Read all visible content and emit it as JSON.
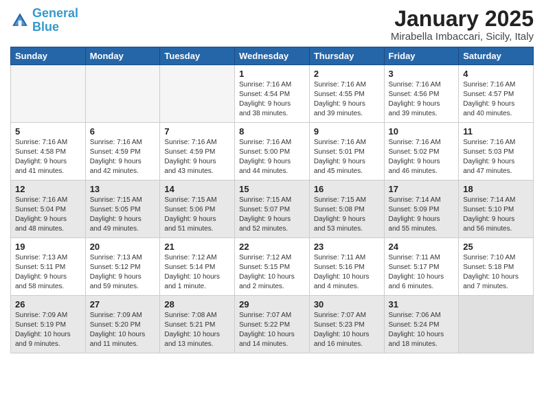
{
  "logo": {
    "line1": "General",
    "line2": "Blue"
  },
  "title": "January 2025",
  "subtitle": "Mirabella Imbaccari, Sicily, Italy",
  "weekdays": [
    "Sunday",
    "Monday",
    "Tuesday",
    "Wednesday",
    "Thursday",
    "Friday",
    "Saturday"
  ],
  "weeks": [
    {
      "shaded": false,
      "days": [
        {
          "num": "",
          "info": ""
        },
        {
          "num": "",
          "info": ""
        },
        {
          "num": "",
          "info": ""
        },
        {
          "num": "1",
          "info": "Sunrise: 7:16 AM\nSunset: 4:54 PM\nDaylight: 9 hours\nand 38 minutes."
        },
        {
          "num": "2",
          "info": "Sunrise: 7:16 AM\nSunset: 4:55 PM\nDaylight: 9 hours\nand 39 minutes."
        },
        {
          "num": "3",
          "info": "Sunrise: 7:16 AM\nSunset: 4:56 PM\nDaylight: 9 hours\nand 39 minutes."
        },
        {
          "num": "4",
          "info": "Sunrise: 7:16 AM\nSunset: 4:57 PM\nDaylight: 9 hours\nand 40 minutes."
        }
      ]
    },
    {
      "shaded": false,
      "days": [
        {
          "num": "5",
          "info": "Sunrise: 7:16 AM\nSunset: 4:58 PM\nDaylight: 9 hours\nand 41 minutes."
        },
        {
          "num": "6",
          "info": "Sunrise: 7:16 AM\nSunset: 4:59 PM\nDaylight: 9 hours\nand 42 minutes."
        },
        {
          "num": "7",
          "info": "Sunrise: 7:16 AM\nSunset: 4:59 PM\nDaylight: 9 hours\nand 43 minutes."
        },
        {
          "num": "8",
          "info": "Sunrise: 7:16 AM\nSunset: 5:00 PM\nDaylight: 9 hours\nand 44 minutes."
        },
        {
          "num": "9",
          "info": "Sunrise: 7:16 AM\nSunset: 5:01 PM\nDaylight: 9 hours\nand 45 minutes."
        },
        {
          "num": "10",
          "info": "Sunrise: 7:16 AM\nSunset: 5:02 PM\nDaylight: 9 hours\nand 46 minutes."
        },
        {
          "num": "11",
          "info": "Sunrise: 7:16 AM\nSunset: 5:03 PM\nDaylight: 9 hours\nand 47 minutes."
        }
      ]
    },
    {
      "shaded": true,
      "days": [
        {
          "num": "12",
          "info": "Sunrise: 7:16 AM\nSunset: 5:04 PM\nDaylight: 9 hours\nand 48 minutes."
        },
        {
          "num": "13",
          "info": "Sunrise: 7:15 AM\nSunset: 5:05 PM\nDaylight: 9 hours\nand 49 minutes."
        },
        {
          "num": "14",
          "info": "Sunrise: 7:15 AM\nSunset: 5:06 PM\nDaylight: 9 hours\nand 51 minutes."
        },
        {
          "num": "15",
          "info": "Sunrise: 7:15 AM\nSunset: 5:07 PM\nDaylight: 9 hours\nand 52 minutes."
        },
        {
          "num": "16",
          "info": "Sunrise: 7:15 AM\nSunset: 5:08 PM\nDaylight: 9 hours\nand 53 minutes."
        },
        {
          "num": "17",
          "info": "Sunrise: 7:14 AM\nSunset: 5:09 PM\nDaylight: 9 hours\nand 55 minutes."
        },
        {
          "num": "18",
          "info": "Sunrise: 7:14 AM\nSunset: 5:10 PM\nDaylight: 9 hours\nand 56 minutes."
        }
      ]
    },
    {
      "shaded": false,
      "days": [
        {
          "num": "19",
          "info": "Sunrise: 7:13 AM\nSunset: 5:11 PM\nDaylight: 9 hours\nand 58 minutes."
        },
        {
          "num": "20",
          "info": "Sunrise: 7:13 AM\nSunset: 5:12 PM\nDaylight: 9 hours\nand 59 minutes."
        },
        {
          "num": "21",
          "info": "Sunrise: 7:12 AM\nSunset: 5:14 PM\nDaylight: 10 hours\nand 1 minute."
        },
        {
          "num": "22",
          "info": "Sunrise: 7:12 AM\nSunset: 5:15 PM\nDaylight: 10 hours\nand 2 minutes."
        },
        {
          "num": "23",
          "info": "Sunrise: 7:11 AM\nSunset: 5:16 PM\nDaylight: 10 hours\nand 4 minutes."
        },
        {
          "num": "24",
          "info": "Sunrise: 7:11 AM\nSunset: 5:17 PM\nDaylight: 10 hours\nand 6 minutes."
        },
        {
          "num": "25",
          "info": "Sunrise: 7:10 AM\nSunset: 5:18 PM\nDaylight: 10 hours\nand 7 minutes."
        }
      ]
    },
    {
      "shaded": true,
      "days": [
        {
          "num": "26",
          "info": "Sunrise: 7:09 AM\nSunset: 5:19 PM\nDaylight: 10 hours\nand 9 minutes."
        },
        {
          "num": "27",
          "info": "Sunrise: 7:09 AM\nSunset: 5:20 PM\nDaylight: 10 hours\nand 11 minutes."
        },
        {
          "num": "28",
          "info": "Sunrise: 7:08 AM\nSunset: 5:21 PM\nDaylight: 10 hours\nand 13 minutes."
        },
        {
          "num": "29",
          "info": "Sunrise: 7:07 AM\nSunset: 5:22 PM\nDaylight: 10 hours\nand 14 minutes."
        },
        {
          "num": "30",
          "info": "Sunrise: 7:07 AM\nSunset: 5:23 PM\nDaylight: 10 hours\nand 16 minutes."
        },
        {
          "num": "31",
          "info": "Sunrise: 7:06 AM\nSunset: 5:24 PM\nDaylight: 10 hours\nand 18 minutes."
        },
        {
          "num": "",
          "info": ""
        }
      ]
    }
  ]
}
